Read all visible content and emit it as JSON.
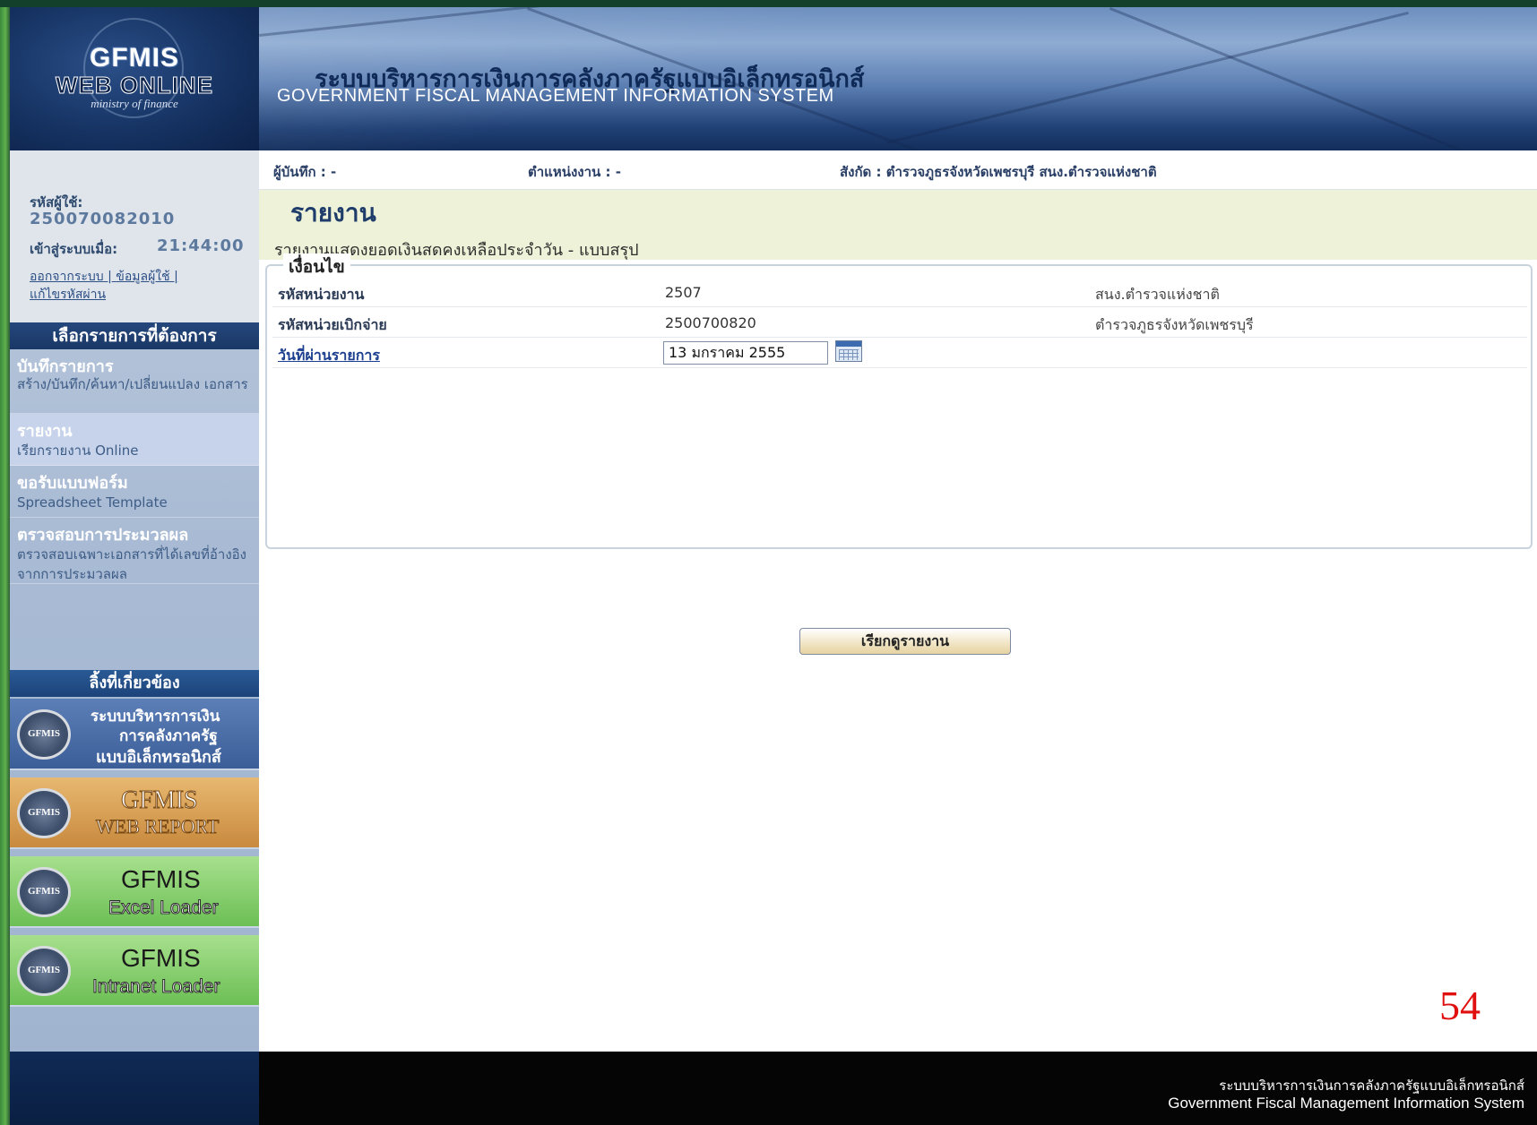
{
  "header": {
    "logo_title": "GFMIS",
    "logo_sub": "WEB ONLINE",
    "logo_ministry": "ministry of finance",
    "system_name_th": "ระบบบริหารการเงินการคลังภาครัฐแบบอิเล็กทรอนิกส์",
    "system_name_en": "GOVERNMENT FISCAL MANAGEMENT INFORMATION SYSTEM"
  },
  "infobar": {
    "recorder": "ผู้บันทึก : -",
    "position": "ตำแหน่งงาน : -",
    "affiliation": "สังกัด : ตำรวจภูธรจังหวัดเพชรบุรี สนง.ตำรวจแห่งชาติ"
  },
  "user": {
    "id_label": "รหัสผู้ใช้:",
    "id_value": "25007008201​0",
    "login_label": "เข้าสู่ระบบเมื่อ:",
    "login_time": "21:44:00",
    "link_logout": "ออกจากระบบ",
    "link_userinfo": "ข้อมูลผู้ใช้",
    "link_password": "แก้ไขรหัสผ่าน"
  },
  "menu": {
    "heading": "เลือกรายการที่ต้องการ",
    "items": [
      {
        "title": "บันทึกรายการ",
        "sub": "สร้าง/บันทึก/ค้นหา/เปลี่ยนแปลง เอกสาร"
      },
      {
        "title": "รายงาน",
        "sub": "เรียกรายงาน Online"
      },
      {
        "title": "ขอรับแบบฟอร์ม",
        "sub": "Spreadsheet Template"
      },
      {
        "title": "ตรวจสอบการประมวลผล",
        "sub": "ตรวจสอบเฉพาะเอกสารที่ได้เลขที่อ้างอิงจากการประมวลผล"
      }
    ]
  },
  "links": {
    "heading": "ลิ้งที่เกี่ยวข้อง",
    "items": [
      {
        "seal": "GFMIS",
        "line1": "ระบบบริหารการเงิน",
        "line2": "การคลังภาครัฐ",
        "line3": "แบบอิเล็กทรอนิกส์"
      },
      {
        "seal": "GFMIS",
        "line1": "GFMIS",
        "line2": "WEB REPORT"
      },
      {
        "seal": "GFMIS",
        "line1": "GFMIS",
        "line2": "Excel Loader"
      },
      {
        "seal": "GFMIS",
        "line1": "GFMIS",
        "line2": "Intranet Loader"
      }
    ]
  },
  "report": {
    "title": "รายงาน",
    "subtitle": "รายงานแสดงยอดเงินสดคงเหลือประจำวัน - แบบสรุป",
    "conditions_legend": "เงื่อนไข",
    "rows": [
      {
        "label": "รหัสหน่วยงาน",
        "value": "2507",
        "desc": "สนง.ตำรวจแห่งชาติ"
      },
      {
        "label": "รหัสหน่วยเบิกจ่าย",
        "value": "2500700820",
        "desc": "ตำรวจภูธรจังหวัดเพชรบุรี"
      }
    ],
    "date_label": "วันที่ผ่านรายการ",
    "date_value": "13 มกราคม 2555",
    "run_button": "เรียกดูรายงาน"
  },
  "page_number": "54",
  "footer": {
    "th": "ระบบบริหารการเงินการคลังภาครัฐแบบอิเล็กทรอนิกส์",
    "en": "Government Fiscal Management Information System"
  },
  "colors": {
    "navy": "#1a3866",
    "condition_bg": "#eef2d8",
    "page_number": "#e01010"
  }
}
